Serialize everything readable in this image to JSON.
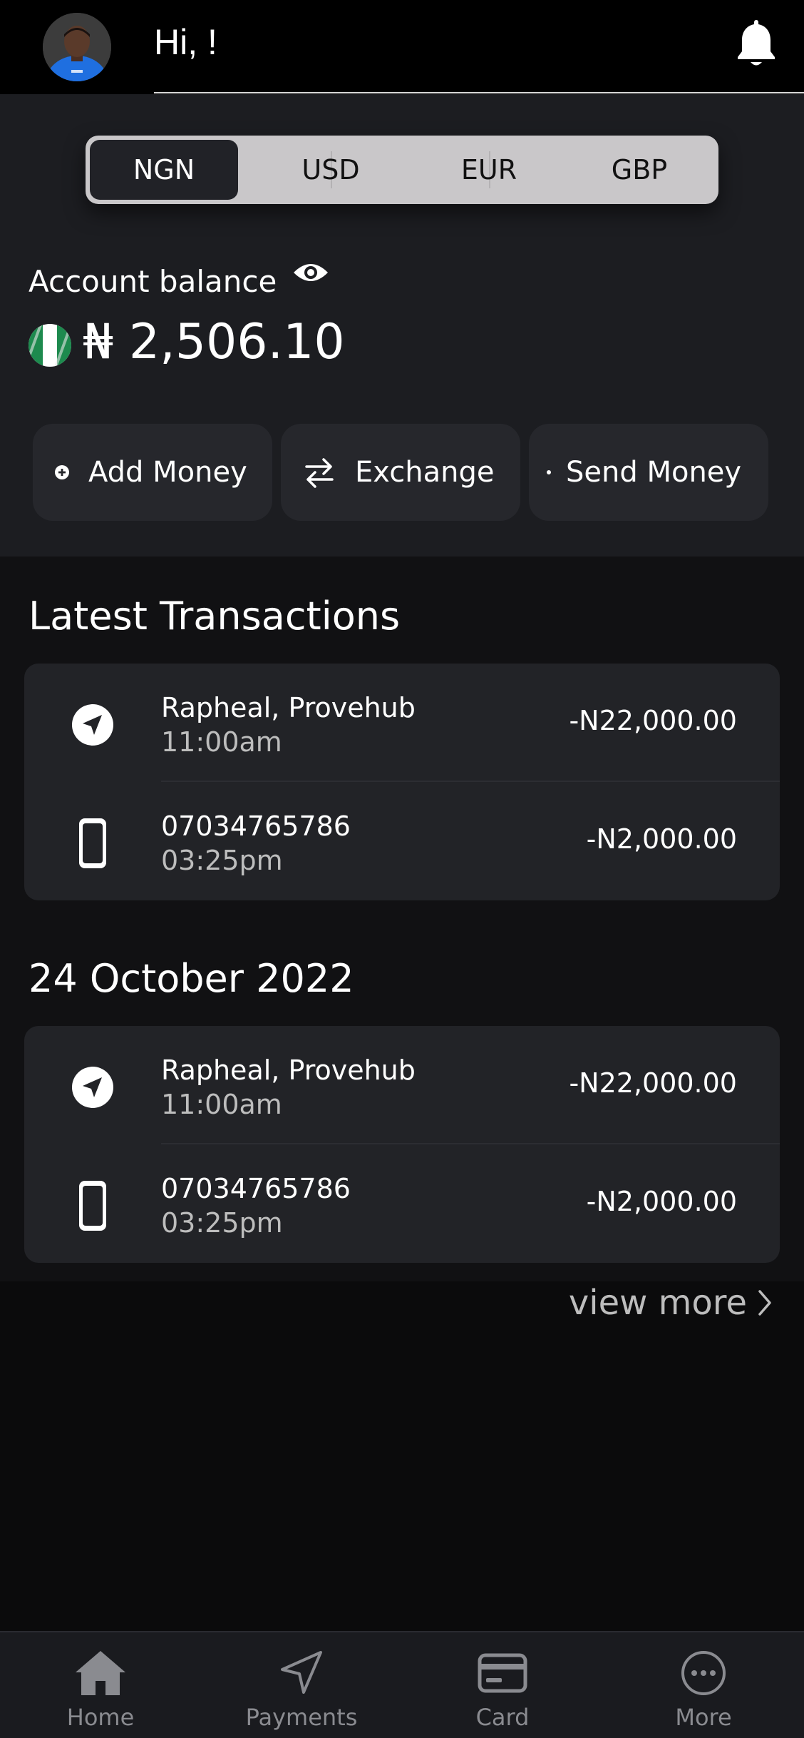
{
  "header": {
    "greeting": "Hi, !",
    "icons": {
      "avatar": "user-avatar",
      "notification": "bell-icon"
    }
  },
  "currency_tabs": {
    "items": [
      "NGN",
      "USD",
      "EUR",
      "GBP"
    ],
    "selected": "NGN"
  },
  "balance": {
    "label": "Account balance",
    "amount": "₦ 2,506.10",
    "flag": "nigeria-flag",
    "visibility_icon": "eye-icon"
  },
  "actions": [
    {
      "label": "Add Money",
      "icon": "plus-circle-icon"
    },
    {
      "label": "Exchange",
      "icon": "exchange-arrows-icon"
    },
    {
      "label": "Send Money",
      "icon": "dot-icon"
    }
  ],
  "sections": [
    {
      "title": "Latest Transactions",
      "transactions": [
        {
          "name": "Rapheal, Provehub",
          "time": "11:00am",
          "amount": "-N22,000.00",
          "icon": "send-arrow-icon"
        },
        {
          "name": "07034765786",
          "time": "03:25pm",
          "amount": "-N2,000.00",
          "icon": "phone-icon"
        }
      ]
    },
    {
      "title": "24 October 2022",
      "transactions": [
        {
          "name": "Rapheal, Provehub",
          "time": "11:00am",
          "amount": "-N22,000.00",
          "icon": "send-arrow-icon"
        },
        {
          "name": "07034765786",
          "time": "03:25pm",
          "amount": "-N2,000.00",
          "icon": "phone-icon"
        }
      ]
    }
  ],
  "view_more": "view more",
  "bottom_nav": [
    {
      "label": "Home",
      "icon": "home-icon"
    },
    {
      "label": "Payments",
      "icon": "navigation-arrow-icon"
    },
    {
      "label": "Card",
      "icon": "credit-card-icon"
    },
    {
      "label": "More",
      "icon": "more-dots-icon"
    }
  ],
  "colors": {
    "header_bg": "#000000",
    "panel_bg": "#1c1d21",
    "page_bg": "#0b0b0c",
    "card_bg": "#222327",
    "segment_bg": "#c9c7c9",
    "segment_active": "#212227",
    "muted_text": "#bdbdbd"
  }
}
